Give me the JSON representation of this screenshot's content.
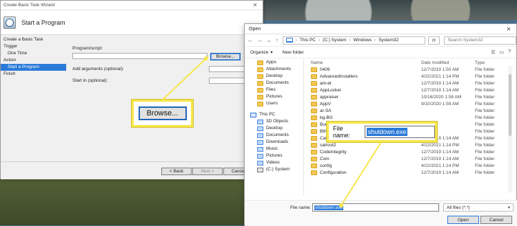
{
  "wizard": {
    "window_title": "Create Basic Task Wizard",
    "header_title": "Start a Program",
    "left_nav": [
      {
        "label": "Create a Basic Task",
        "indent": false,
        "selected": false
      },
      {
        "label": "Trigger",
        "indent": false,
        "selected": false
      },
      {
        "label": "One Time",
        "indent": true,
        "selected": false
      },
      {
        "label": "Action",
        "indent": false,
        "selected": false
      },
      {
        "label": "Start a Program",
        "indent": true,
        "selected": true
      },
      {
        "label": "Finish",
        "indent": false,
        "selected": false
      }
    ],
    "program_script_label": "Program/script:",
    "browse_label": "Browse...",
    "add_arguments_label": "Add arguments (optional):",
    "start_in_label": "Start in (optional):",
    "back_label": "< Back",
    "next_label": "Next >",
    "cancel_label": "Cancel"
  },
  "zoom_browse": {
    "label": "Browse..."
  },
  "open_dialog": {
    "window_title": "Open",
    "breadcrumb": [
      "This PC",
      "(C:) System",
      "Windows",
      "System32"
    ],
    "search_placeholder": "Search System32",
    "organize_label": "Organize",
    "new_folder_label": "New folder",
    "nav_items": [
      {
        "label": "Apps",
        "icon": "folder"
      },
      {
        "label": "Attachments",
        "icon": "folder"
      },
      {
        "label": "Desktop",
        "icon": "folder"
      },
      {
        "label": "Documents",
        "icon": "folder"
      },
      {
        "label": "Files",
        "icon": "folder"
      },
      {
        "label": "Pictures",
        "icon": "folder"
      },
      {
        "label": "Users",
        "icon": "folder"
      },
      {
        "label": "This PC",
        "icon": "pc"
      },
      {
        "label": "3D Objects",
        "icon": "obj"
      },
      {
        "label": "Desktop",
        "icon": "obj"
      },
      {
        "label": "Documents",
        "icon": "obj"
      },
      {
        "label": "Downloads",
        "icon": "obj"
      },
      {
        "label": "Music",
        "icon": "obj"
      },
      {
        "label": "Pictures",
        "icon": "obj"
      },
      {
        "label": "Videos",
        "icon": "obj"
      },
      {
        "label": "(C:) System",
        "icon": "c"
      }
    ],
    "columns": {
      "name": "Name",
      "date": "Date modified",
      "type": "Type"
    },
    "files": [
      {
        "name": "0409",
        "date": "12/7/2019 1:50 AM",
        "type": "File folder"
      },
      {
        "name": "AdvancedInstallers",
        "date": "4/22/2021 1:14 PM",
        "type": "File folder"
      },
      {
        "name": "am-et",
        "date": "12/7/2019 1:14 AM",
        "type": "File folder"
      },
      {
        "name": "AppLocker",
        "date": "12/7/2019 1:14 AM",
        "type": "File folder"
      },
      {
        "name": "appraiser",
        "date": "10/16/2020 1:58 AM",
        "type": "File folder"
      },
      {
        "name": "AppV",
        "date": "9/10/2020 1:59 AM",
        "type": "File folder"
      },
      {
        "name": "ar-SA",
        "date": "",
        "type": "File folder"
      },
      {
        "name": "bg-BG",
        "date": "",
        "type": "File folder"
      },
      {
        "name": "Boot",
        "date": "",
        "type": "File folder"
      },
      {
        "name": "Bthprops",
        "date": "",
        "type": "File folder"
      },
      {
        "name": "CatRoot",
        "date": "12/7/2019 1:14 AM",
        "type": "File folder"
      },
      {
        "name": "catroot2",
        "date": "4/22/2021 1:14 PM",
        "type": "File folder"
      },
      {
        "name": "CodeIntegrity",
        "date": "12/7/2019 1:14 AM",
        "type": "File folder"
      },
      {
        "name": "Com",
        "date": "12/7/2019 1:14 AM",
        "type": "File folder"
      },
      {
        "name": "config",
        "date": "4/22/2021 1:14 PM",
        "type": "File folder"
      },
      {
        "name": "Configuration",
        "date": "12/7/2019 1:14 AM",
        "type": "File folder"
      }
    ],
    "file_name_label": "File name:",
    "file_name_value": "shutdown.exe",
    "filter_value": "All files (*.*)",
    "open_label": "Open",
    "cancel_label": "Cancel"
  },
  "zoom_filename": {
    "label": "File name:",
    "value": "shutdown.exe"
  },
  "colors": {
    "callout_yellow": "#f7e64a",
    "selection_blue": "#2b7ad8"
  }
}
